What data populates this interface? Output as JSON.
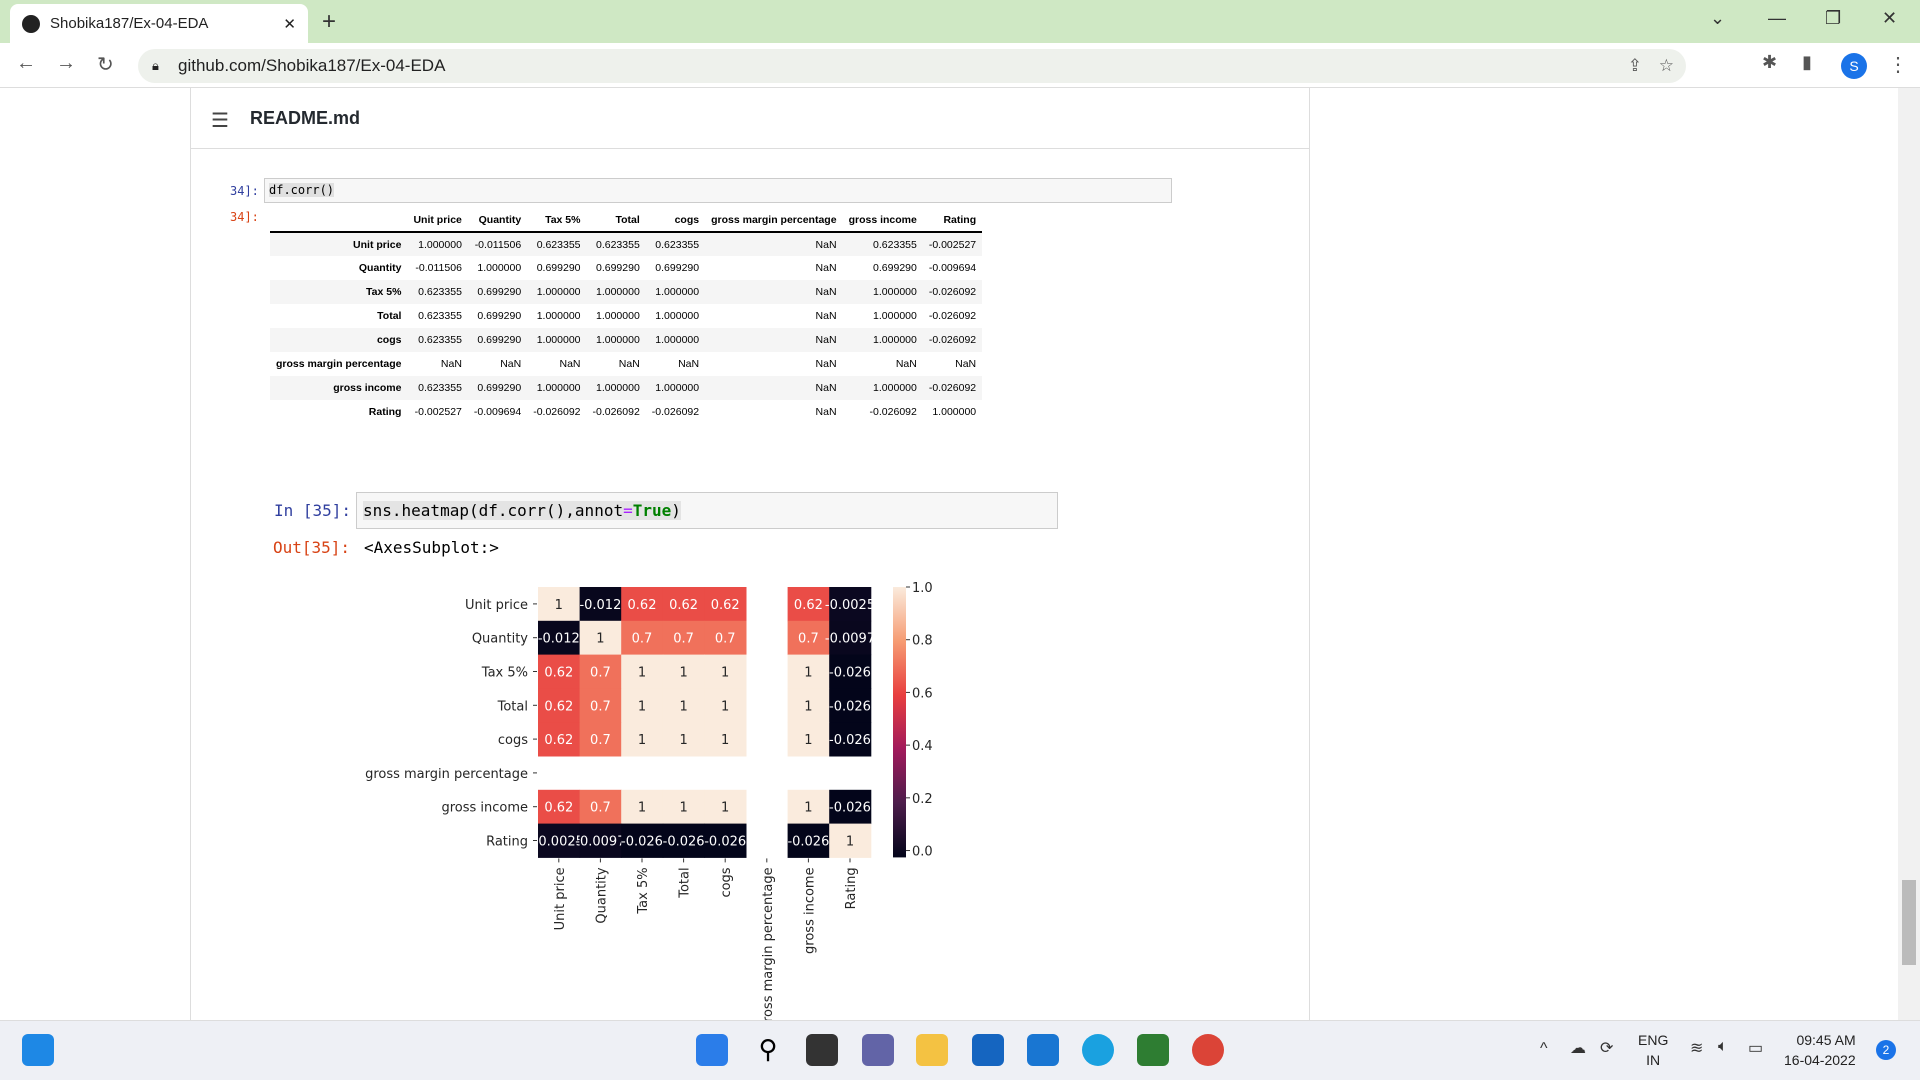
{
  "browser": {
    "tab_title": "Shobika187/Ex-04-EDA",
    "url": "github.com/Shobika187/Ex-04-EDA",
    "profile_initial": "S"
  },
  "file": {
    "name": "README.md"
  },
  "cell34": {
    "in_prompt": "34]:",
    "code": "df.corr()",
    "out_prompt": "34]:"
  },
  "table": {
    "columns": [
      "Unit price",
      "Quantity",
      "Tax 5%",
      "Total",
      "cogs",
      "gross margin percentage",
      "gross income",
      "Rating"
    ],
    "rows": [
      {
        "label": "Unit price",
        "values": [
          "1.000000",
          "-0.011506",
          "0.623355",
          "0.623355",
          "0.623355",
          "NaN",
          "0.623355",
          "-0.002527"
        ]
      },
      {
        "label": "Quantity",
        "values": [
          "-0.011506",
          "1.000000",
          "0.699290",
          "0.699290",
          "0.699290",
          "NaN",
          "0.699290",
          "-0.009694"
        ]
      },
      {
        "label": "Tax 5%",
        "values": [
          "0.623355",
          "0.699290",
          "1.000000",
          "1.000000",
          "1.000000",
          "NaN",
          "1.000000",
          "-0.026092"
        ]
      },
      {
        "label": "Total",
        "values": [
          "0.623355",
          "0.699290",
          "1.000000",
          "1.000000",
          "1.000000",
          "NaN",
          "1.000000",
          "-0.026092"
        ]
      },
      {
        "label": "cogs",
        "values": [
          "0.623355",
          "0.699290",
          "1.000000",
          "1.000000",
          "1.000000",
          "NaN",
          "1.000000",
          "-0.026092"
        ]
      },
      {
        "label": "gross margin percentage",
        "values": [
          "NaN",
          "NaN",
          "NaN",
          "NaN",
          "NaN",
          "NaN",
          "NaN",
          "NaN"
        ]
      },
      {
        "label": "gross income",
        "values": [
          "0.623355",
          "0.699290",
          "1.000000",
          "1.000000",
          "1.000000",
          "NaN",
          "1.000000",
          "-0.026092"
        ]
      },
      {
        "label": "Rating",
        "values": [
          "-0.002527",
          "-0.009694",
          "-0.026092",
          "-0.026092",
          "-0.026092",
          "NaN",
          "-0.026092",
          "1.000000"
        ]
      }
    ]
  },
  "cell35": {
    "in_prompt": "In [35]:",
    "code_pre": "sns.heatmap(df.corr(),annot",
    "code_eq": "=",
    "code_kw": "True",
    "code_post": ")",
    "out_prompt": "Out[35]:",
    "output": "<AxesSubplot:>"
  },
  "chart_data": {
    "type": "heatmap",
    "labels": [
      "Unit price",
      "Quantity",
      "Tax 5%",
      "Total",
      "cogs",
      "gross margin percentage",
      "gross income",
      "Rating"
    ],
    "values": [
      [
        1,
        -0.012,
        0.62,
        0.62,
        0.62,
        null,
        0.62,
        -0.0025
      ],
      [
        -0.012,
        1,
        0.7,
        0.7,
        0.7,
        null,
        0.7,
        -0.0097
      ],
      [
        0.62,
        0.7,
        1,
        1,
        1,
        null,
        1,
        -0.026
      ],
      [
        0.62,
        0.7,
        1,
        1,
        1,
        null,
        1,
        -0.026
      ],
      [
        0.62,
        0.7,
        1,
        1,
        1,
        null,
        1,
        -0.026
      ],
      [
        null,
        null,
        null,
        null,
        null,
        null,
        null,
        null
      ],
      [
        0.62,
        0.7,
        1,
        1,
        1,
        null,
        1,
        -0.026
      ],
      [
        -0.0025,
        -0.0097,
        -0.026,
        -0.026,
        -0.026,
        null,
        -0.026,
        1
      ]
    ],
    "annotations": [
      [
        "1",
        "-0.012",
        "0.62",
        "0.62",
        "0.62",
        "",
        "0.62",
        "-0.0025"
      ],
      [
        "-0.012",
        "1",
        "0.7",
        "0.7",
        "0.7",
        "",
        "0.7",
        "-0.0097"
      ],
      [
        "0.62",
        "0.7",
        "1",
        "1",
        "1",
        "",
        "1",
        "-0.026"
      ],
      [
        "0.62",
        "0.7",
        "1",
        "1",
        "1",
        "",
        "1",
        "-0.026"
      ],
      [
        "0.62",
        "0.7",
        "1",
        "1",
        "1",
        "",
        "1",
        "-0.026"
      ],
      [
        "",
        "",
        "",
        "",
        "",
        "",
        "",
        ""
      ],
      [
        "0.62",
        "0.7",
        "1",
        "1",
        "1",
        "",
        "1",
        "-0.026"
      ],
      [
        "-0.0025",
        "-0.0097",
        "-0.026",
        "-0.026",
        "-0.026",
        "",
        "-0.026",
        "1"
      ]
    ],
    "colorbar_ticks": [
      "0.0",
      "0.2",
      "0.4",
      "0.6",
      "0.8",
      "1.0"
    ],
    "colorbar_range": [
      -0.026,
      1
    ],
    "colormap": [
      "#03051a",
      "#4c1d4b",
      "#a11a5b",
      "#e83f3f",
      "#f69c73",
      "#faebdd"
    ]
  },
  "taskbar": {
    "lang1": "ENG",
    "lang2": "IN",
    "time": "09:45 AM",
    "date": "16-04-2022",
    "notif": "2"
  }
}
